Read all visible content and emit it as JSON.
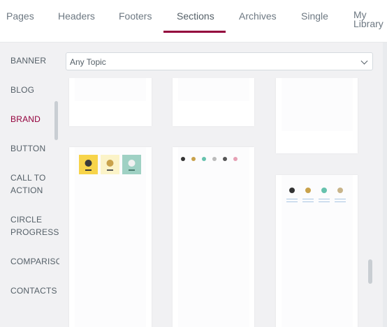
{
  "tabs": [
    {
      "label": "Pages",
      "active": false
    },
    {
      "label": "Headers",
      "active": false
    },
    {
      "label": "Footers",
      "active": false
    },
    {
      "label": "Sections",
      "active": true
    },
    {
      "label": "Archives",
      "active": false
    },
    {
      "label": "Single",
      "active": false
    }
  ],
  "tab_library": {
    "line1": "My",
    "line2": "Library"
  },
  "sidebar": {
    "items": [
      {
        "label": "BANNER"
      },
      {
        "label": "BLOG"
      },
      {
        "label": "BRAND",
        "active": true
      },
      {
        "label": "BUTTON"
      },
      {
        "label_line1": "CALL TO",
        "label_line2": "ACTION"
      },
      {
        "label_line1": "CIRCLE",
        "label_line2": "PROGRESS"
      },
      {
        "label": "COMPARISON"
      },
      {
        "label": "CONTACTS"
      }
    ]
  },
  "topic_select": {
    "value": "Any Topic"
  },
  "colors": {
    "accent": "#93003c",
    "card_yellow": "#f7d44a",
    "card_cream": "#fbf3c8",
    "card_teal": "#9fd1c4"
  },
  "icons": {
    "dropdown": "chevron-down-icon"
  }
}
